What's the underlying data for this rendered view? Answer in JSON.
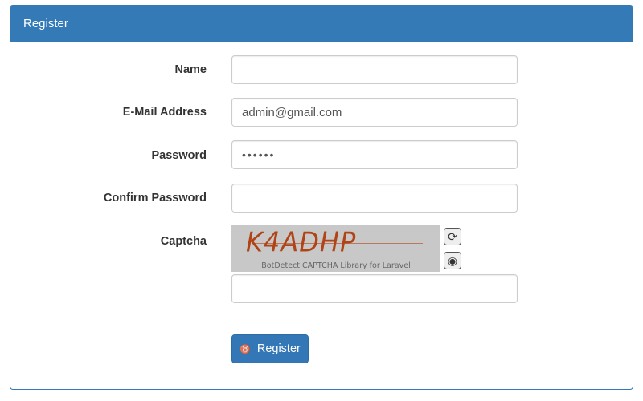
{
  "panel": {
    "title": "Register"
  },
  "form": {
    "name": {
      "label": "Name",
      "value": ""
    },
    "email": {
      "label": "E-Mail Address",
      "value": "admin@gmail.com"
    },
    "password": {
      "label": "Password",
      "value": "••••••"
    },
    "confirm_password": {
      "label": "Confirm Password",
      "value": ""
    },
    "captcha": {
      "label": "Captcha",
      "code_text": "K4ADHP",
      "caption": "BotDetect CAPTCHA Library for Laravel",
      "reload_icon": "reload-icon",
      "sound_icon": "sound-icon",
      "input_value": ""
    },
    "submit": {
      "label": "Register",
      "icon": "user-icon"
    }
  },
  "colors": {
    "primary": "#337ab7",
    "captcha_text": "#b04416"
  }
}
